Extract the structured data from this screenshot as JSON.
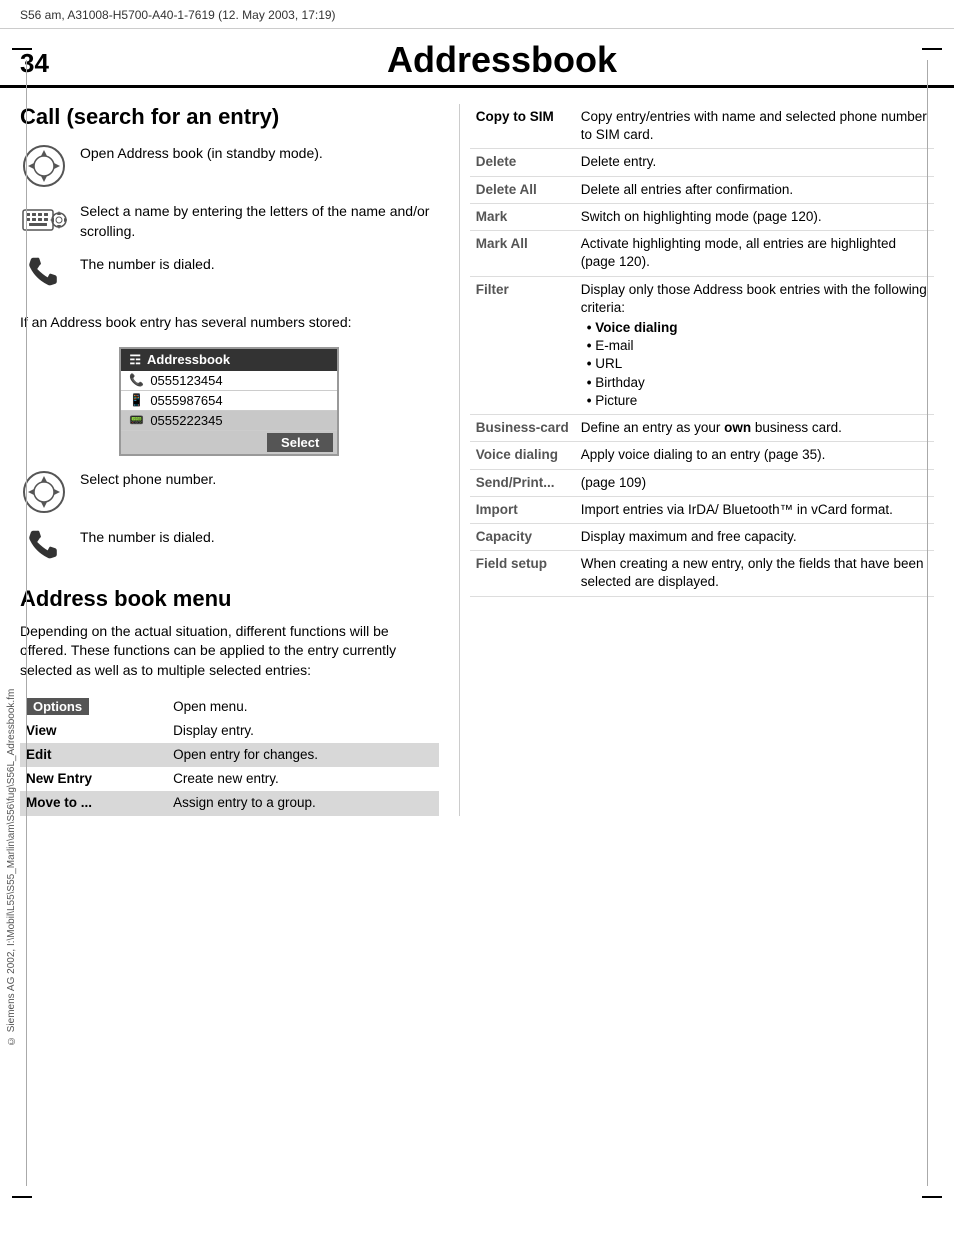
{
  "meta": {
    "header_text": "S56 am, A31008-H5700-A40-1-7619 (12. May 2003, 17:19)"
  },
  "page": {
    "number": "34",
    "title": "Addressbook"
  },
  "left_section": {
    "title": "Call (search for an entry)",
    "steps": [
      {
        "id": "step1",
        "icon_type": "nav",
        "text": "Open Address book (in standby mode)."
      },
      {
        "id": "step2",
        "icon_type": "keyboard",
        "text": "Select a name by entering the letters of the name and/or scrolling."
      },
      {
        "id": "step3",
        "icon_type": "handset",
        "text": "The number is dialed."
      }
    ],
    "paragraph": "If an Address book entry has several numbers stored:",
    "phone_screen": {
      "header": "Addressbook",
      "rows": [
        {
          "icon": "phone",
          "number": "0555123454",
          "selected": false
        },
        {
          "icon": "mobile",
          "number": "0555987654",
          "selected": false
        },
        {
          "icon": "fax",
          "number": "0555222345",
          "selected": true
        }
      ],
      "select_button": "Select"
    },
    "steps2": [
      {
        "id": "step4",
        "icon_type": "nav",
        "text": "Select phone number."
      },
      {
        "id": "step5",
        "icon_type": "handset",
        "text": "The number is dialed."
      }
    ]
  },
  "address_book_menu": {
    "title": "Address book menu",
    "intro": "Depending on the actual situation, different functions will be offered. These functions can be applied to the entry currently selected as well as to multiple selected entries:",
    "options_label": "Options",
    "options_desc": "Open menu.",
    "menu_items": [
      {
        "label": "View",
        "desc": "Display entry.",
        "shaded": false
      },
      {
        "label": "Edit",
        "desc": "Open entry for changes.",
        "shaded": true
      },
      {
        "label": "New Entry",
        "desc": "Create new entry.",
        "shaded": false
      },
      {
        "label": "Move to ...",
        "desc": "Assign entry to a group.",
        "shaded": true
      }
    ]
  },
  "right_menu": {
    "items": [
      {
        "label": "Copy to SIM",
        "desc": "Copy entry/entries with name and selected phone number to SIM card.",
        "label_color": "black"
      },
      {
        "label": "Delete",
        "desc": "Delete entry.",
        "label_color": "gray"
      },
      {
        "label": "Delete All",
        "desc": "Delete all entries after confirmation.",
        "label_color": "gray"
      },
      {
        "label": "Mark",
        "desc": "Switch on highlighting mode (page 120).",
        "label_color": "gray"
      },
      {
        "label": "Mark All",
        "desc": "Activate highlighting mode, all entries are highlighted (page 120).",
        "label_color": "gray"
      },
      {
        "label": "Filter",
        "desc": "Display only those Address book entries with the following criteria:",
        "filter_list": [
          {
            "text": "Voice dialing",
            "bold": true
          },
          {
            "text": "E-mail",
            "bold": false
          },
          {
            "text": "URL",
            "bold": false
          },
          {
            "text": "Birthday",
            "bold": false
          },
          {
            "text": "Picture",
            "bold": false
          }
        ],
        "label_color": "gray"
      },
      {
        "label": "Business-card",
        "desc": "Define an entry as your own business card.",
        "has_bold_own": true,
        "label_color": "gray"
      },
      {
        "label": "Voice dialing",
        "desc": "Apply voice dialing to an entry (page 35).",
        "label_color": "gray"
      },
      {
        "label": "Send/Print...",
        "desc": "(page 109)",
        "label_color": "gray"
      },
      {
        "label": "Import",
        "desc": "Import entries via IrDA/ Bluetooth™ in vCard format.",
        "label_color": "gray"
      },
      {
        "label": "Capacity",
        "desc": "Display maximum and free capacity.",
        "label_color": "gray"
      },
      {
        "label": "Field setup",
        "desc": "When creating a new entry,  only the fields that have been selected are displayed.",
        "label_color": "gray"
      }
    ]
  },
  "copyright": "© Siemens AG 2002, I:\\Mobil\\L55\\S55_Marlin\\am\\S56\\fug\\S56L_Adressbook.fm"
}
